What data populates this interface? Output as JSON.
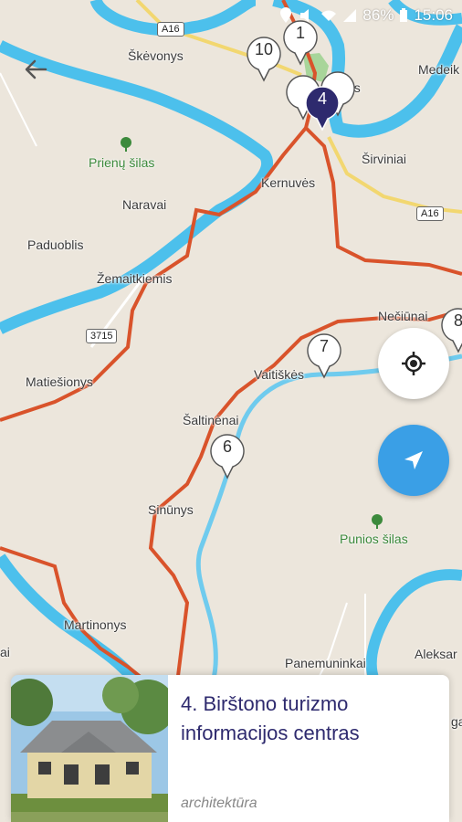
{
  "status_bar": {
    "battery": "86%",
    "time": "15:06"
  },
  "places": [
    {
      "id": "skevonys",
      "label": "Škėvonys"
    },
    {
      "id": "medeik",
      "label": "Medeik"
    },
    {
      "id": "birstonas",
      "label": "as"
    },
    {
      "id": "sirviniai",
      "label": "Širviniai"
    },
    {
      "id": "kernuves",
      "label": "Kernuvės"
    },
    {
      "id": "naravai",
      "label": "Naravai"
    },
    {
      "id": "paduoblis",
      "label": "Paduoblis"
    },
    {
      "id": "zemaitkiemis",
      "label": "Žemaitkiemis"
    },
    {
      "id": "neciunai",
      "label": "Nečiūnai"
    },
    {
      "id": "matiesionys",
      "label": "Matiešionys"
    },
    {
      "id": "vaitiskes",
      "label": "Vaitiškės"
    },
    {
      "id": "saltinenai",
      "label": "Šaltinėnai"
    },
    {
      "id": "sinunys",
      "label": "Sinūnys"
    },
    {
      "id": "martinonys",
      "label": "Martinonys"
    },
    {
      "id": "panemuninkai",
      "label": "Panemuninkai"
    },
    {
      "id": "aleksan",
      "label": "Aleksar"
    },
    {
      "id": "edge_left",
      "label": "ai"
    },
    {
      "id": "edge_right",
      "label": "ga"
    }
  ],
  "forests": [
    {
      "id": "prienu",
      "label": "Prienų šilas"
    },
    {
      "id": "punios",
      "label": "Punios šilas"
    }
  ],
  "road_shields": [
    {
      "id": "a16-top",
      "label": "A16"
    },
    {
      "id": "a16-right",
      "label": "A16"
    },
    {
      "id": "r3715",
      "label": "3715"
    }
  ],
  "markers": [
    {
      "id": "1",
      "label": "1",
      "active": false
    },
    {
      "id": "10",
      "label": "10",
      "active": false
    },
    {
      "id": "4",
      "label": "4",
      "active": true
    },
    {
      "id": "7",
      "label": "7",
      "active": false
    },
    {
      "id": "6",
      "label": "6",
      "active": false
    },
    {
      "id": "8",
      "label": "8",
      "active": false
    }
  ],
  "card": {
    "title": "4. Birštono turizmo informacijos centras",
    "category": "architektūra"
  },
  "colors": {
    "land": "#ece6dc",
    "water": "#4cc0ec",
    "route": "#d9532b",
    "road": "#f2d770",
    "forest_label": "#3c8a3c",
    "active_marker": "#2e2a6e",
    "nav_button": "#3a9fe6",
    "card_title": "#2e2a6e"
  },
  "icons": {
    "back": "arrow-left-icon",
    "locate": "crosshair-icon",
    "navigate": "navigation-arrow-icon"
  }
}
